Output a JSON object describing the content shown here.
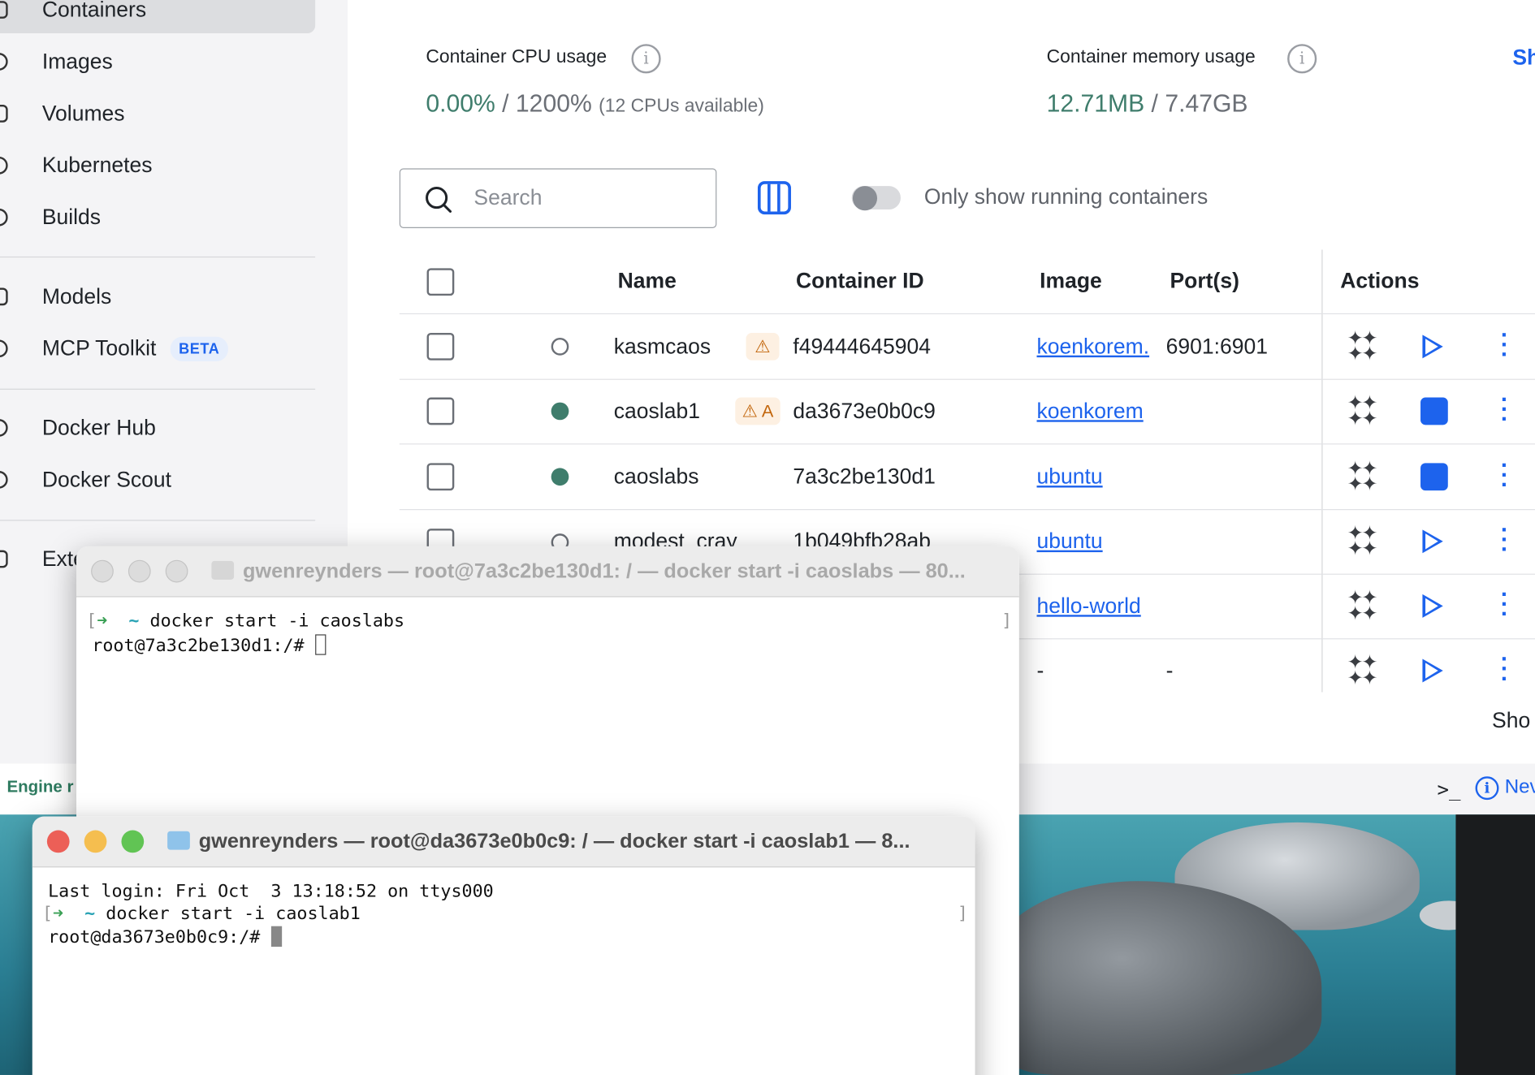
{
  "sidebar": {
    "items": [
      {
        "label": "Containers",
        "icon": "container-icon"
      },
      {
        "label": "Images",
        "icon": "images-icon"
      },
      {
        "label": "Volumes",
        "icon": "volumes-icon"
      },
      {
        "label": "Kubernetes",
        "icon": "kubernetes-icon"
      },
      {
        "label": "Builds",
        "icon": "builds-icon"
      },
      {
        "label": "Models",
        "icon": "models-icon"
      },
      {
        "label": "MCP Toolkit",
        "icon": "mcp-icon",
        "badge": "BETA"
      },
      {
        "label": "Docker Hub",
        "icon": "hub-icon"
      },
      {
        "label": "Docker Scout",
        "icon": "scout-icon"
      },
      {
        "label": "Exte",
        "icon": "extensions-icon"
      }
    ],
    "engine_status": "Engine r"
  },
  "stats": {
    "cpu_label": "Container CPU usage",
    "cpu_used": "0.00%",
    "cpu_sep": " / ",
    "cpu_total": "1200%",
    "cpu_note": "(12 CPUs available)",
    "mem_label": "Container memory usage",
    "mem_used": "12.71MB",
    "mem_sep": " / ",
    "mem_total": "7.47GB",
    "show_link": "Sh"
  },
  "toolbar": {
    "search_placeholder": "Search",
    "toggle_label": "Only show running containers",
    "toggle_on": false
  },
  "table": {
    "headers": {
      "name": "Name",
      "id": "Container ID",
      "image": "Image",
      "ports": "Port(s)",
      "actions": "Actions"
    },
    "rows": [
      {
        "name": "kasmcaos",
        "warning": "⚠",
        "id": "f49444645904",
        "image": "koenkorem.",
        "ports": "6901:6901",
        "running": false
      },
      {
        "name": "caoslab1",
        "warning": "⚠ A",
        "id": "da3673e0b0c9",
        "image": "koenkorem",
        "ports": "",
        "running": true
      },
      {
        "name": "caoslabs",
        "warning": "",
        "id": "7a3c2be130d1",
        "image": "ubuntu",
        "ports": "",
        "running": true
      },
      {
        "name": "modest_cray",
        "warning": "",
        "id": "1b049bfb28ab",
        "image": "ubuntu",
        "ports": "",
        "running": false
      },
      {
        "name": "",
        "warning": "",
        "id": "",
        "image": "hello-world",
        "ports": "",
        "running": false
      },
      {
        "name": "",
        "warning": "",
        "id": "",
        "image": "-",
        "ports": "-",
        "running": false
      }
    ],
    "show_more": "Sho"
  },
  "footer": {
    "terminal_icon": ">_",
    "news_label": "Nev"
  },
  "terminal_back": {
    "title": "gwenreynders — root@7a3c2be130d1: / — docker start -i caoslabs — 80...",
    "line1_prompt": "~",
    "line1_cmd": "docker start -i caoslabs",
    "line2": "root@7a3c2be130d1:/# "
  },
  "terminal_front": {
    "title": "gwenreynders — root@da3673e0b0c9: / — docker start -i caoslab1 — 8...",
    "line0": "Last login: Fri Oct  3 13:18:52 on ttys000",
    "line1_prompt": "~",
    "line1_cmd": "docker start -i caoslab1",
    "line2": "root@da3673e0b0c9:/# "
  },
  "colors": {
    "accent": "#1d63ed",
    "running": "#3f7d6c",
    "warning": "#c2650a",
    "close": "#ec5f57",
    "minimize": "#f5be4f",
    "maximize": "#61c454"
  }
}
